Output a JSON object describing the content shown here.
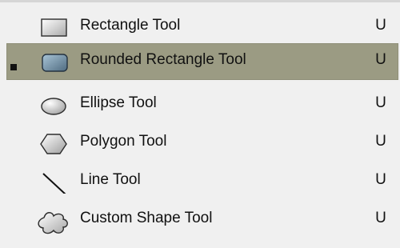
{
  "menu": {
    "items": [
      {
        "label": "Rectangle Tool",
        "shortcut": "U",
        "icon": "rectangle-icon",
        "active": false,
        "highlighted": false
      },
      {
        "label": "Rounded Rectangle Tool",
        "shortcut": "U",
        "icon": "rounded-rectangle-icon",
        "active": true,
        "highlighted": true
      },
      {
        "label": "Ellipse Tool",
        "shortcut": "U",
        "icon": "ellipse-icon",
        "active": false,
        "highlighted": false
      },
      {
        "label": "Polygon Tool",
        "shortcut": "U",
        "icon": "polygon-icon",
        "active": false,
        "highlighted": false
      },
      {
        "label": "Line Tool",
        "shortcut": "U",
        "icon": "line-icon",
        "active": false,
        "highlighted": false
      },
      {
        "label": "Custom Shape Tool",
        "shortcut": "U",
        "icon": "custom-shape-icon",
        "active": false,
        "highlighted": false
      }
    ]
  },
  "colors": {
    "background": "#f0f0f0",
    "highlight": "#9b9b83",
    "text": "#111111"
  }
}
